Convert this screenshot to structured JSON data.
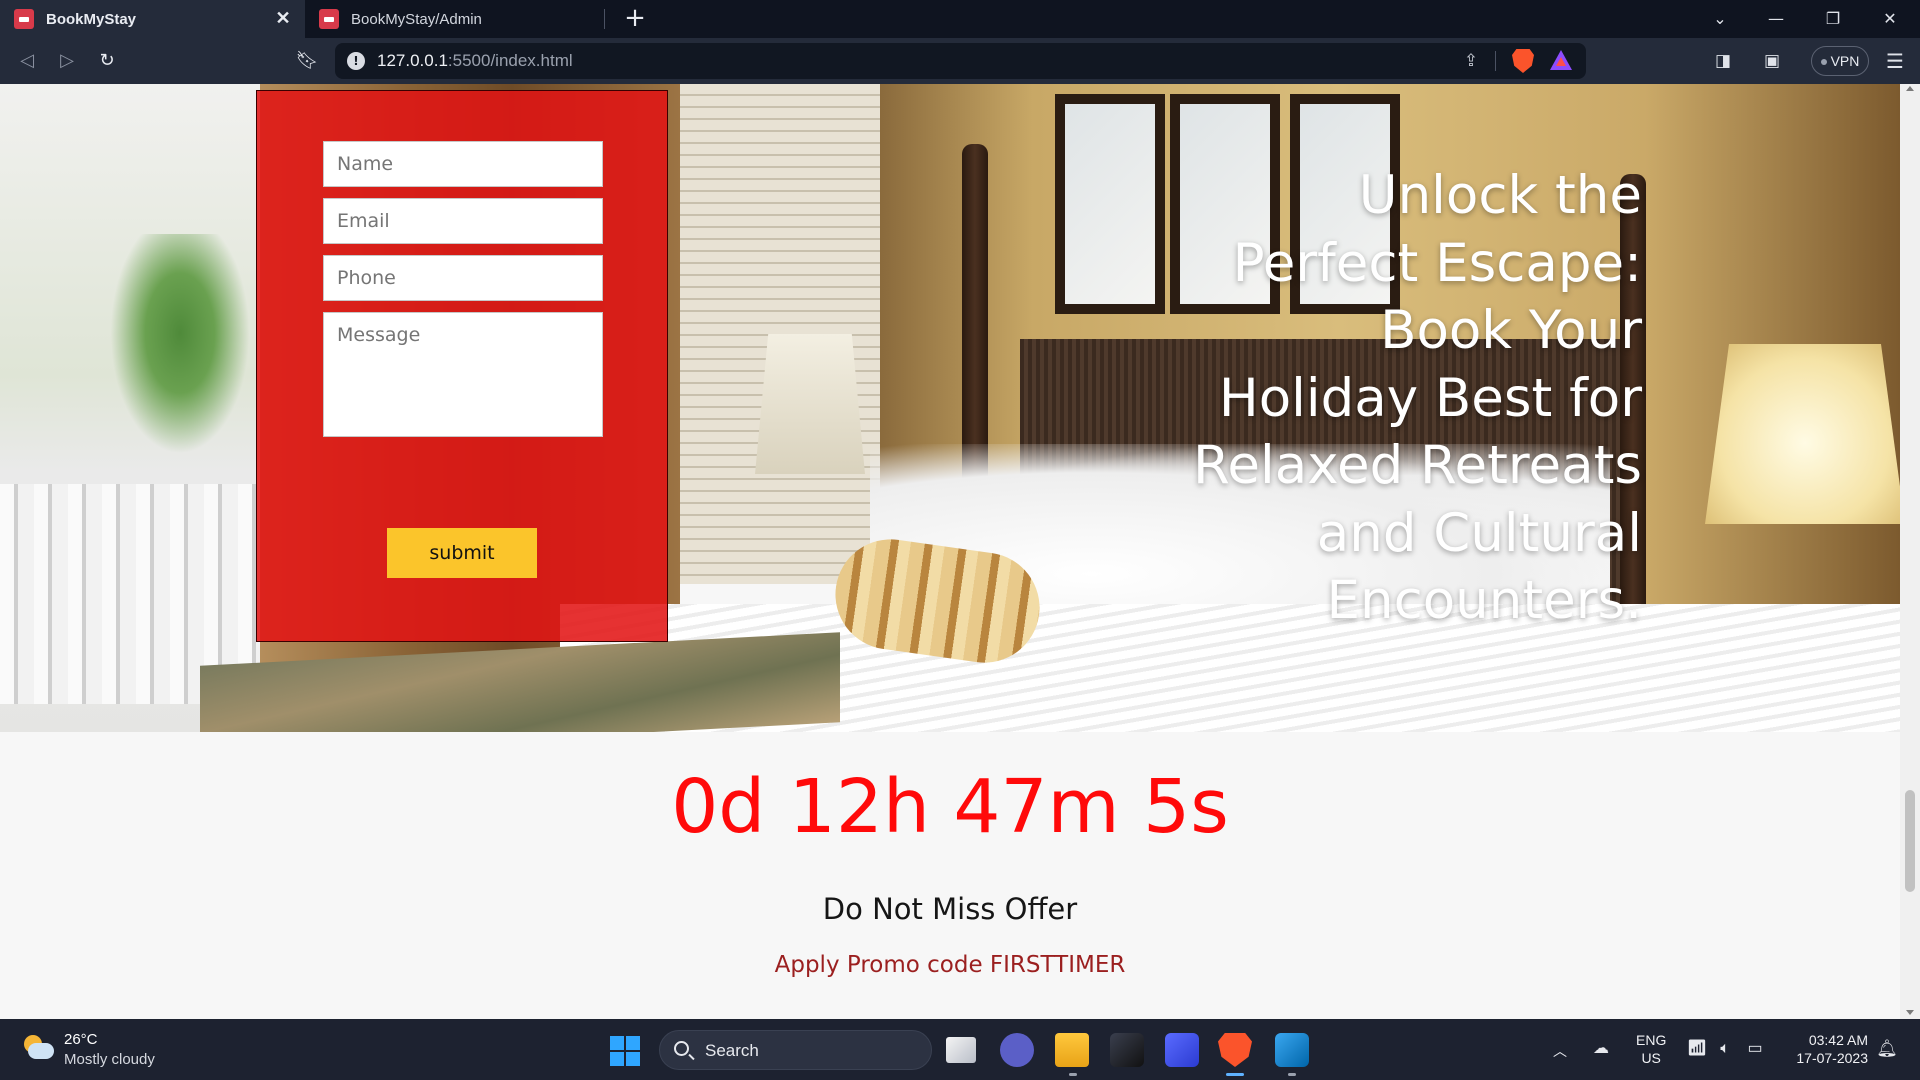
{
  "browser": {
    "tabs": [
      {
        "label": "BookMyStay",
        "active": true
      },
      {
        "label": "BookMyStay/Admin",
        "active": false
      }
    ],
    "url": {
      "host": "127.0.0.1",
      "rest": ":5500/index.html"
    },
    "vpn_label": "VPN"
  },
  "page": {
    "form": {
      "name_placeholder": "Name",
      "email_placeholder": "Email",
      "phone_placeholder": "Phone",
      "message_placeholder": "Message",
      "submit_label": "submit"
    },
    "headline_lines": [
      "Unlock the",
      "Perfect Escape:",
      "Book Your",
      "Holiday Best for",
      "Relaxed Retreats",
      "and Cultural",
      "Encounters."
    ],
    "countdown": "0d 12h 47m 5s",
    "offer_title": "Do Not Miss Offer",
    "promo_text": "Apply Promo code FIRSTTIMER"
  },
  "taskbar": {
    "weather_temp": "26°C",
    "weather_desc": "Mostly cloudy",
    "search_label": "Search",
    "lang_primary": "ENG",
    "lang_secondary": "US",
    "time": "03:42 AM",
    "date": "17-07-2023"
  },
  "colors": {
    "form_bg": "#e21414",
    "submit_bg": "#fbc52b",
    "countdown": "#ff0a0a",
    "promo": "#9b1f1f"
  }
}
